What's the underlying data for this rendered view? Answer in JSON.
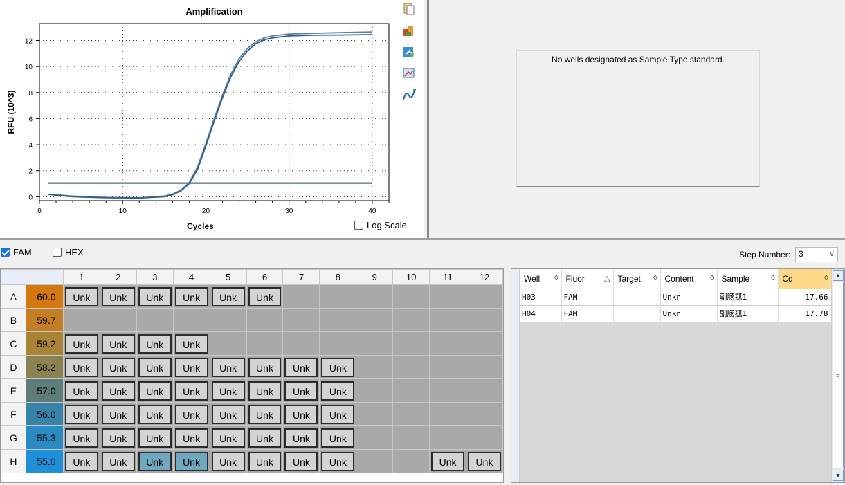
{
  "chart_data": {
    "type": "line",
    "title": "Amplification",
    "xlabel": "Cycles",
    "ylabel": "RFU (10^3)",
    "xlim": [
      0,
      42
    ],
    "ylim": [
      -0.3,
      13.3
    ],
    "xticks": [
      0,
      10,
      20,
      30,
      40
    ],
    "yticks": [
      0,
      2,
      4,
      6,
      8,
      10,
      12
    ],
    "grid": true,
    "series": [
      {
        "color": "#5b7fa6",
        "x": [
          1,
          4,
          8,
          12,
          15,
          16,
          17,
          18,
          19,
          20,
          21,
          22,
          23,
          24,
          25,
          26,
          27,
          28,
          30,
          33,
          36,
          40
        ],
        "y": [
          0.2,
          0.05,
          -0.05,
          -0.08,
          0.05,
          0.2,
          0.5,
          1.1,
          2.3,
          4.1,
          6.0,
          7.8,
          9.4,
          10.6,
          11.4,
          11.9,
          12.2,
          12.35,
          12.5,
          12.55,
          12.6,
          12.65
        ]
      },
      {
        "color": "#2f5f8a",
        "x": [
          1,
          4,
          8,
          12,
          15,
          16,
          17,
          18,
          19,
          20,
          21,
          22,
          23,
          24,
          25,
          26,
          27,
          28,
          30,
          33,
          36,
          40
        ],
        "y": [
          0.18,
          0.0,
          -0.08,
          -0.1,
          0.0,
          0.15,
          0.45,
          1.0,
          2.1,
          3.9,
          5.8,
          7.6,
          9.2,
          10.4,
          11.2,
          11.75,
          12.05,
          12.2,
          12.35,
          12.4,
          12.42,
          12.45
        ]
      }
    ],
    "threshold": {
      "y": 1.05,
      "color": "#1f4e79"
    }
  },
  "toolbar": {
    "icons": [
      "copy-icon",
      "export-icon",
      "refresh-icon",
      "image-icon",
      "curve-icon"
    ]
  },
  "log_scale": {
    "label": "Log Scale",
    "checked": false
  },
  "standard_curve": {
    "message": "No wells designated as Sample Type standard."
  },
  "fluorophores": [
    {
      "label": "FAM",
      "checked": true
    },
    {
      "label": "HEX",
      "checked": false
    }
  ],
  "step_number": {
    "label": "Step Number:",
    "value": "3"
  },
  "plate": {
    "columns": [
      "1",
      "2",
      "3",
      "4",
      "5",
      "6",
      "7",
      "8",
      "9",
      "10",
      "11",
      "12"
    ],
    "rows": [
      {
        "label": "A",
        "temp": "60.0",
        "temp_color": "#d4790f",
        "wells": [
          "Unk",
          "Unk",
          "Unk",
          "Unk",
          "Unk",
          "Unk",
          "",
          "",
          "",
          "",
          "",
          ""
        ]
      },
      {
        "label": "B",
        "temp": "59.7",
        "temp_color": "#c47f24",
        "wells": [
          "",
          "",
          "",
          "",
          "",
          "",
          "",
          "",
          "",
          "",
          "",
          ""
        ]
      },
      {
        "label": "C",
        "temp": "59.2",
        "temp_color": "#a98436",
        "wells": [
          "Unk",
          "Unk",
          "Unk",
          "Unk",
          "",
          "",
          "",
          "",
          "",
          "",
          "",
          ""
        ]
      },
      {
        "label": "D",
        "temp": "58.2",
        "temp_color": "#8a8250",
        "wells": [
          "Unk",
          "Unk",
          "Unk",
          "Unk",
          "Unk",
          "Unk",
          "Unk",
          "Unk",
          "",
          "",
          "",
          ""
        ]
      },
      {
        "label": "E",
        "temp": "57.0",
        "temp_color": "#5f7d78",
        "wells": [
          "Unk",
          "Unk",
          "Unk",
          "Unk",
          "Unk",
          "Unk",
          "Unk",
          "Unk",
          "",
          "",
          "",
          ""
        ]
      },
      {
        "label": "F",
        "temp": "56.0",
        "temp_color": "#3a83a8",
        "wells": [
          "Unk",
          "Unk",
          "Unk",
          "Unk",
          "Unk",
          "Unk",
          "Unk",
          "Unk",
          "",
          "",
          "",
          ""
        ]
      },
      {
        "label": "G",
        "temp": "55.3",
        "temp_color": "#2a8ac2",
        "wells": [
          "Unk",
          "Unk",
          "Unk",
          "Unk",
          "Unk",
          "Unk",
          "Unk",
          "Unk",
          "",
          "",
          "",
          ""
        ]
      },
      {
        "label": "H",
        "temp": "55.0",
        "temp_color": "#1e8fd8",
        "wells": [
          "Unk",
          "Unk",
          "Unk",
          "Unk",
          "Unk",
          "Unk",
          "Unk",
          "Unk",
          "",
          "",
          "Unk",
          "Unk"
        ]
      }
    ],
    "selected": [
      "H3",
      "H4"
    ]
  },
  "results": {
    "headers": [
      "Well",
      "Fluor",
      "Target",
      "Content",
      "Sample",
      "Cq"
    ],
    "sort_glyphs": [
      "◊",
      "△",
      "◊",
      "◊",
      "◊",
      "◊"
    ],
    "rows": [
      {
        "well": "H03",
        "fluor": "FAM",
        "target": "",
        "content": "Unkn",
        "sample": "副肠孤1",
        "cq": "17.66"
      },
      {
        "well": "H04",
        "fluor": "FAM",
        "target": "",
        "content": "Unkn",
        "sample": "副肠孤1",
        "cq": "17.78"
      }
    ]
  }
}
